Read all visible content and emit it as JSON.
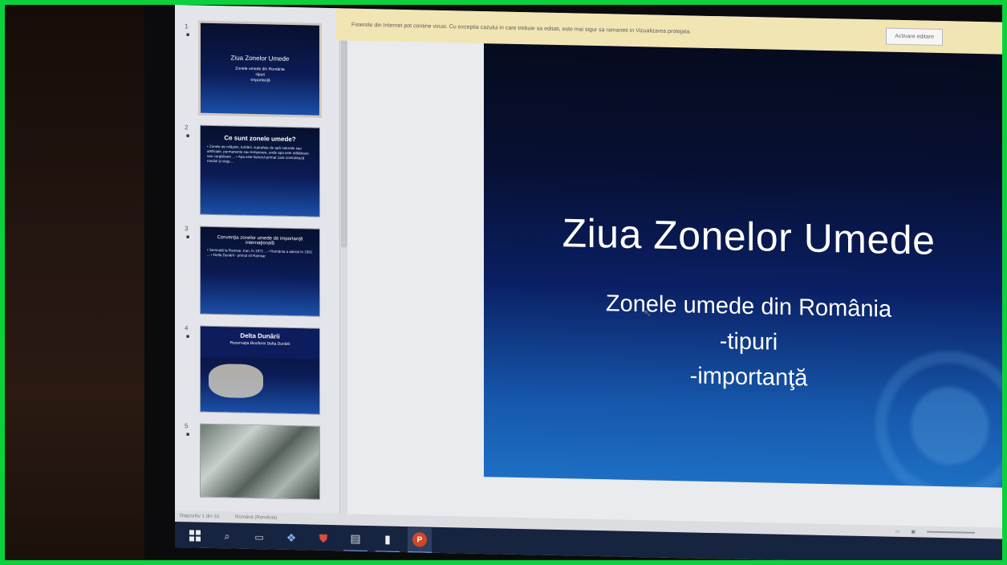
{
  "notice_bar": {
    "message": "Fisierele din Internet pot contine virusi. Cu exceptia cazului in care trebuie sa editati, este mai sigur sa ramaneti in Vizualizarea protejata.",
    "enable_button": "Activare editare"
  },
  "thumbnails": [
    {
      "number": "1",
      "title": "Ziua Zonelor Umede",
      "sub": [
        "Zonele umede din România",
        "-tipuri",
        "-importanţă"
      ]
    },
    {
      "number": "2",
      "title": "Ce sunt zonele umede?",
      "bullets": "• Zonele de mlăştini, turbării, suprafeţe de apă naturale sau artificiale, permanente sau temporare, unde apa este stătătoare sau curgătoare ... • Apa este factorul primar care controlează mediul şi viaţa ..."
    },
    {
      "number": "3",
      "title": "Convenţia zonelor umede de importanţă internaţională",
      "bullets": "• Semnată la Ramsar, Iran, în 1971 ... • România a aderat în 1991 ... • Delta Dunării - primul sit Ramsar"
    },
    {
      "number": "4",
      "title": "Delta Dunării",
      "bullets": "Rezervaţia Biosferei Delta Dunării"
    },
    {
      "number": "5",
      "title": "",
      "bullets": ""
    }
  ],
  "slide": {
    "title": "Ziua Zonelor Umede",
    "subtitle_lines": [
      "Zonele umede din România",
      "-tipuri",
      "-importanţă"
    ]
  },
  "status_bar": {
    "slide_info": "Diapozitiv 1 din 10",
    "language": "Română (România)"
  },
  "taskbar": {
    "items": [
      "windows-start",
      "search",
      "task-view",
      "file-explorer",
      "antivirus",
      "store",
      "document",
      "powerpoint"
    ]
  }
}
